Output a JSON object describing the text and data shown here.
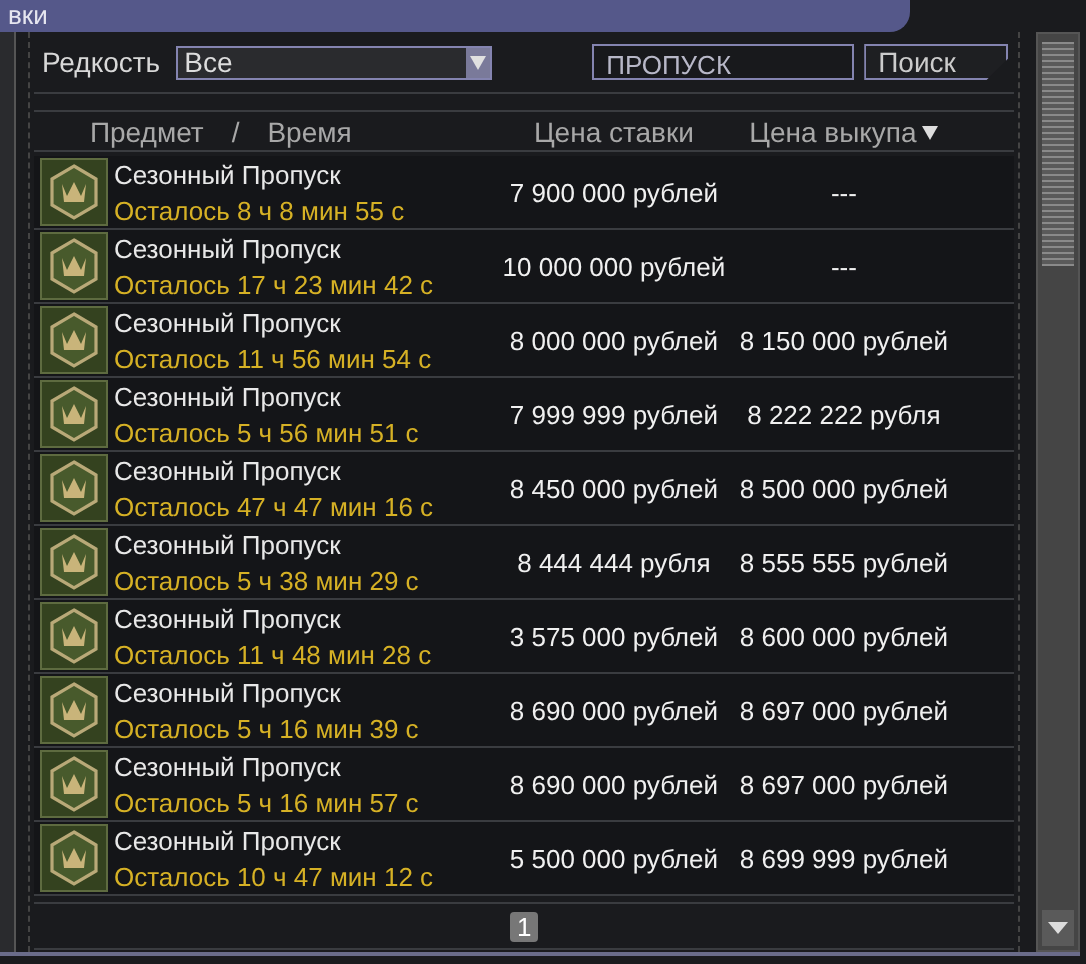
{
  "window": {
    "title": "вки"
  },
  "filter": {
    "label": "Редкость",
    "dropdown_value": "Все",
    "search_value": "ПРОПУСК",
    "search_button": "Поиск"
  },
  "header": {
    "item": "Предмет",
    "separator": "/",
    "time": "Время",
    "bid": "Цена ставки",
    "buyout": "Цена выкупа",
    "buyout_sorted": true
  },
  "rows": [
    {
      "name": "Сезонный Пропуск",
      "time_left": "Осталось 8 ч 8 мин 55 с",
      "bid": "7 900 000 рублей",
      "buyout": "---"
    },
    {
      "name": "Сезонный Пропуск",
      "time_left": "Осталось 17 ч 23 мин 42 с",
      "bid": "10 000 000 рублей",
      "buyout": "---"
    },
    {
      "name": "Сезонный Пропуск",
      "time_left": "Осталось 11 ч 56 мин 54 с",
      "bid": "8 000 000 рублей",
      "buyout": "8 150 000 рублей"
    },
    {
      "name": "Сезонный Пропуск",
      "time_left": "Осталось 5 ч 56 мин 51 с",
      "bid": "7 999 999 рублей",
      "buyout": "8 222 222 рубля"
    },
    {
      "name": "Сезонный Пропуск",
      "time_left": "Осталось 47 ч 47 мин 16 с",
      "bid": "8 450 000 рублей",
      "buyout": "8 500 000 рублей"
    },
    {
      "name": "Сезонный Пропуск",
      "time_left": "Осталось 5 ч 38 мин 29 с",
      "bid": "8 444 444 рубля",
      "buyout": "8 555 555 рублей"
    },
    {
      "name": "Сезонный Пропуск",
      "time_left": "Осталось 11 ч 48 мин 28 с",
      "bid": "3 575 000 рублей",
      "buyout": "8 600 000 рублей"
    },
    {
      "name": "Сезонный Пропуск",
      "time_left": "Осталось 5 ч 16 мин 39 с",
      "bid": "8 690 000 рублей",
      "buyout": "8 697 000 рублей"
    },
    {
      "name": "Сезонный Пропуск",
      "time_left": "Осталось 5 ч 16 мин 57 с",
      "bid": "8 690 000 рублей",
      "buyout": "8 697 000 рублей"
    },
    {
      "name": "Сезонный Пропуск",
      "time_left": "Осталось 10 ч 47 мин 12 с",
      "bid": "5 500 000 рублей",
      "buyout": "8 699 999 рублей"
    }
  ],
  "pagination": [
    {
      "label": "1",
      "selected": true
    }
  ]
}
